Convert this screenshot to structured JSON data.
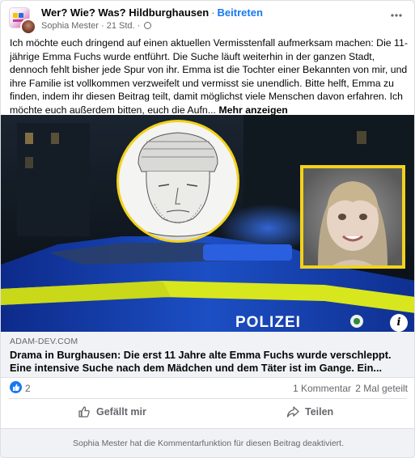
{
  "post": {
    "group_name": "Wer? Wie? Was? Hildburghausen",
    "separator": "·",
    "join_label": "Beitreten",
    "author": "Sophia Mester",
    "time": "21 Std.",
    "time_separator": "·",
    "more_icon": "more-horizontal-icon",
    "body": "Ich möchte euch dringend auf einen aktuellen Vermisstenfall aufmerksam machen: Die 11-jährige Emma Fuchs wurde entführt. Die Suche läuft weiterhin in der ganzen Stadt, dennoch fehlt bisher jede Spur von ihr. Emma ist die Tochter einer Bekannten von mir, und ihre Familie ist vollkommen verzweifelt und vermisst sie unendlich. Bitte helft, Emma zu finden, indem ihr diesen Beitrag teilt, damit möglichst viele Menschen davon erfahren. Ich möchte euch außerdem bitten, euch die Aufn...",
    "see_more": "Mehr anzeigen"
  },
  "image": {
    "car_label": "POLIZEI",
    "info_label": "i"
  },
  "link": {
    "domain": "ADAM-DEV.COM",
    "title": "Drama in Burghausen: Die erst 11 Jahre alte Emma Fuchs wurde verschleppt. Eine intensive Suche nach dem Mädchen und dem Täter ist im Gange. Ein..."
  },
  "stats": {
    "likes": "2",
    "comments": "1 Kommentar",
    "shares": "2 Mal geteilt"
  },
  "actions": {
    "like": "Gefällt mir",
    "share": "Teilen"
  },
  "footer": {
    "notice": "Sophia Mester hat die Kommentarfunktion für diesen Beitrag deaktiviert."
  },
  "colors": {
    "accent": "#1877f2",
    "muted": "#65676b",
    "highlight_border": "#f2d21a",
    "police_blue": "#1c4fc4",
    "police_yellow": "#d8e61e"
  }
}
